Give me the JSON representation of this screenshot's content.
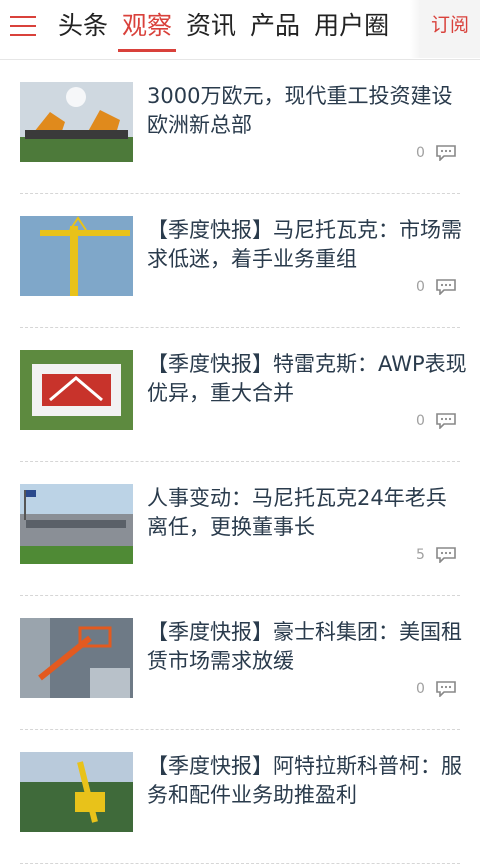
{
  "header": {
    "tabs": [
      "头条",
      "观察",
      "资讯",
      "产品",
      "用户圈"
    ],
    "active_tab": 1,
    "subscribe_label": "订阅",
    "menu_icon": "hamburger-menu-icon"
  },
  "accent_color": "#d9413b",
  "articles": [
    {
      "title": "3000万欧元，现代重工投资建设欧洲新总部",
      "comments": "0",
      "thumb": "excavators-ceremony"
    },
    {
      "title": "【季度快报】马尼托瓦克：市场需求低迷，着手业务重组",
      "comments": "0",
      "thumb": "tower-crane"
    },
    {
      "title": "【季度快报】特雷克斯：AWP表现优异，重大合并",
      "comments": "0",
      "thumb": "crowd-logo"
    },
    {
      "title": "人事变动：马尼托瓦克24年老兵离任，更换董事长",
      "comments": "5",
      "thumb": "office-building"
    },
    {
      "title": "【季度快报】豪士科集团：美国租赁市场需求放缓",
      "comments": "0",
      "thumb": "aerial-platform"
    },
    {
      "title": "【季度快报】阿特拉斯科普柯：服务和配件业务助推盈利",
      "comments": "",
      "thumb": "drilling-rig"
    }
  ]
}
